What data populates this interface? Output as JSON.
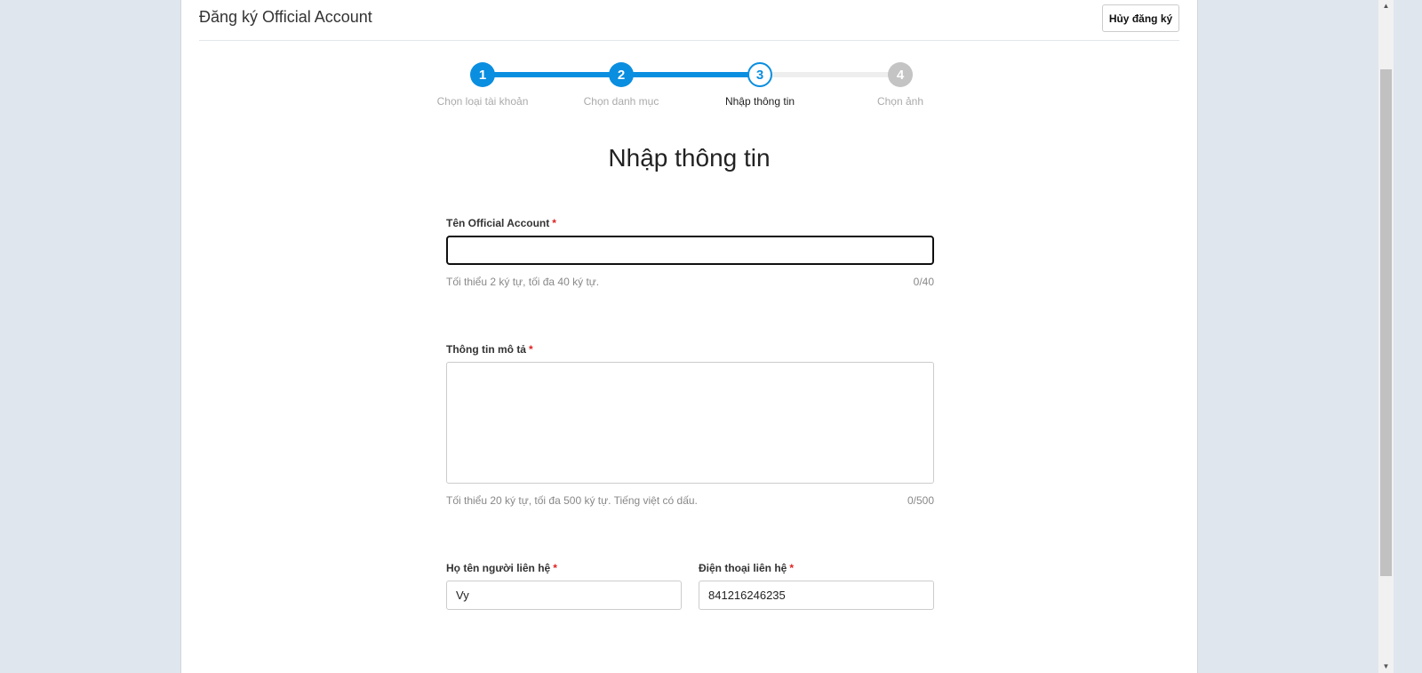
{
  "header": {
    "title": "Đăng ký Official Account",
    "cancel_label": "Hủy đăng ký"
  },
  "steps": [
    {
      "number": "1",
      "label": "Chọn loại tài khoản",
      "state": "done"
    },
    {
      "number": "2",
      "label": "Chọn danh mục",
      "state": "done"
    },
    {
      "number": "3",
      "label": "Nhập thông tin",
      "state": "active"
    },
    {
      "number": "4",
      "label": "Chọn ảnh",
      "state": "pending"
    }
  ],
  "colors": {
    "accent": "#0a8ee0",
    "pending": "#c4c4c4",
    "track": "#eeeeee"
  },
  "form": {
    "heading": "Nhập thông tin",
    "name": {
      "label": "Tên Official Account",
      "required": "*",
      "value": "",
      "hint": "Tối thiểu 2 ký tự, tối đa 40 ký tự.",
      "counter": "0/40"
    },
    "description": {
      "label": "Thông tin mô tả",
      "required": "*",
      "value": "",
      "hint": "Tối thiểu 20 ký tự, tối đa 500 ký tự. Tiếng việt có dấu.",
      "counter": "0/500"
    },
    "contact_name": {
      "label": "Họ tên người liên hệ",
      "required": "*",
      "value": "Vy"
    },
    "contact_phone": {
      "label": "Điện thoại liên hệ",
      "required": "*",
      "value": "841216246235"
    }
  }
}
